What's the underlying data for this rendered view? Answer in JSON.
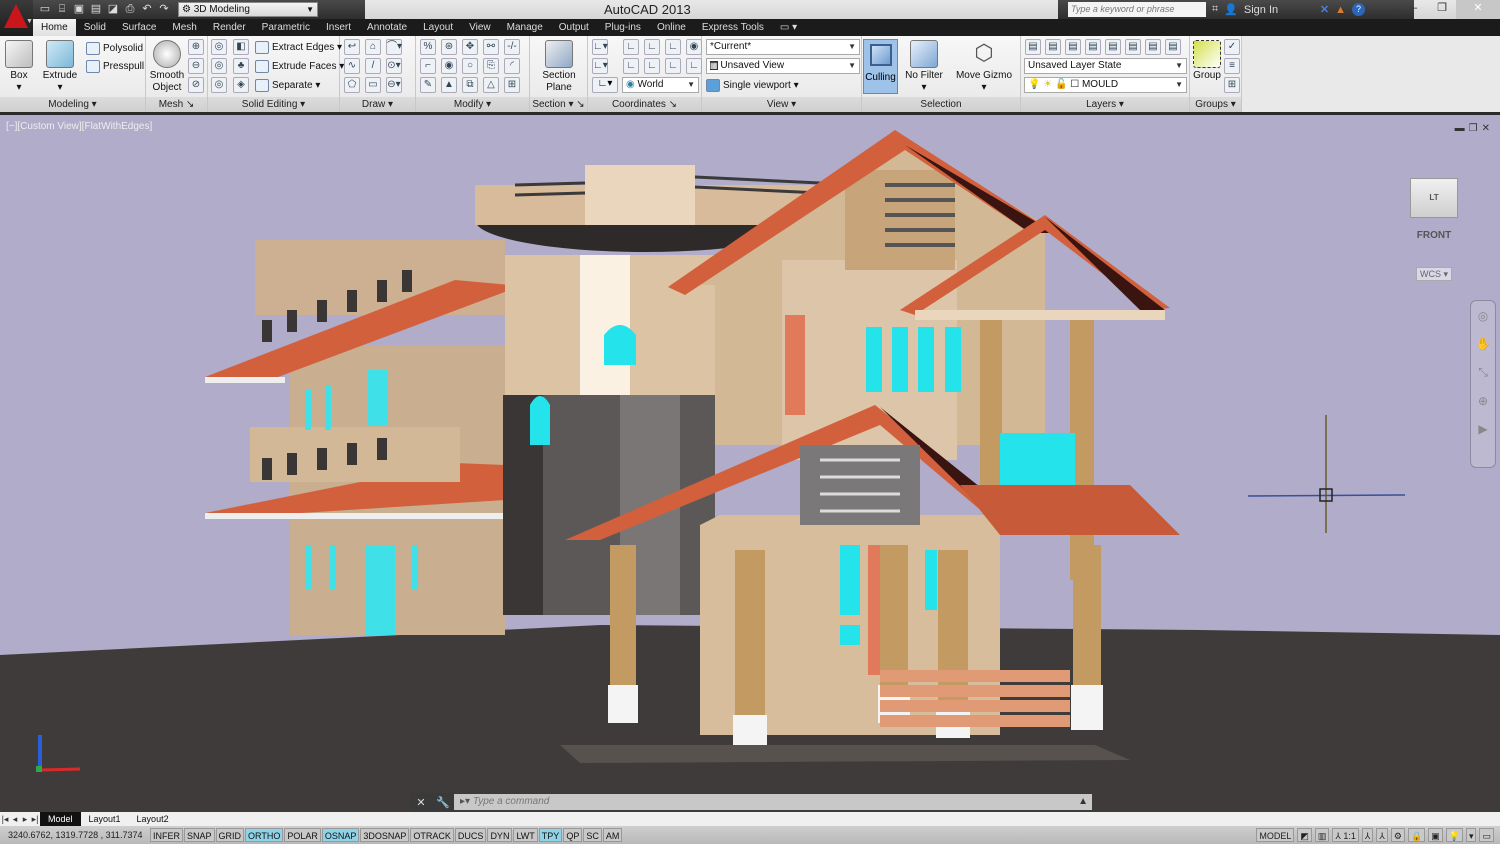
{
  "app": {
    "title": "AutoCAD 2013",
    "workspace": "3D Modeling",
    "search_placeholder": "Type a keyword or phrase",
    "sign_in": "Sign In"
  },
  "quick_access": [
    "new-icon",
    "open-icon",
    "save-icon",
    "saveas-icon",
    "publish-icon",
    "print-icon",
    "undo-icon",
    "redo-icon"
  ],
  "tabs": [
    {
      "label": "Home",
      "active": true
    },
    {
      "label": "Solid"
    },
    {
      "label": "Surface"
    },
    {
      "label": "Mesh"
    },
    {
      "label": "Render"
    },
    {
      "label": "Parametric"
    },
    {
      "label": "Insert"
    },
    {
      "label": "Annotate"
    },
    {
      "label": "Layout"
    },
    {
      "label": "View"
    },
    {
      "label": "Manage"
    },
    {
      "label": "Output"
    },
    {
      "label": "Plug-ins"
    },
    {
      "label": "Online"
    },
    {
      "label": "Express Tools"
    }
  ],
  "ribbon": {
    "modeling": {
      "title": "Modeling",
      "box": "Box",
      "extrude": "Extrude",
      "polysolid": "Polysolid",
      "presspull": "Presspull"
    },
    "mesh": {
      "title": "Mesh",
      "smooth": "Smooth Object"
    },
    "solid_editing": {
      "title": "Solid Editing",
      "extract_edges": "Extract Edges",
      "extrude_faces": "Extrude Faces",
      "separate": "Separate"
    },
    "draw": {
      "title": "Draw"
    },
    "modify": {
      "title": "Modify"
    },
    "section": {
      "title": "Section",
      "section_plane": "Section Plane"
    },
    "coordinates": {
      "title": "Coordinates",
      "ucs": "World"
    },
    "view": {
      "title": "View",
      "visual_style": "*Current*",
      "named_view": "Unsaved View",
      "viewport": "Single viewport"
    },
    "selection": {
      "title": "Selection",
      "culling": "Culling",
      "no_filter": "No Filter",
      "move_gizmo": "Move Gizmo"
    },
    "layers": {
      "title": "Layers",
      "layer_state": "Unsaved Layer State",
      "layer": "MOULD"
    },
    "groups": {
      "title": "Groups",
      "group": "Group"
    }
  },
  "viewport": {
    "label": "[−][Custom View][FlatWithEdges]",
    "viewcube_face": "FRONT",
    "viewcube_side": "LT",
    "ucs_label": "WCS",
    "colors": {
      "sky": "#b0acc9",
      "ground": "#3f3b3a",
      "roof": "#d2603c",
      "wall": "#d9bfa0",
      "glass": "#25e3ea"
    }
  },
  "command_line": {
    "placeholder": "Type a command"
  },
  "layout_tabs": [
    {
      "label": "Model",
      "active": true
    },
    {
      "label": "Layout1"
    },
    {
      "label": "Layout2"
    }
  ],
  "status": {
    "coordinates": "3240.6762, 1319.7728 , 311.7374",
    "toggles": [
      {
        "label": "INFER",
        "on": false
      },
      {
        "label": "SNAP",
        "on": false
      },
      {
        "label": "GRID",
        "on": false
      },
      {
        "label": "ORTHO",
        "on": true
      },
      {
        "label": "POLAR",
        "on": false
      },
      {
        "label": "OSNAP",
        "on": true
      },
      {
        "label": "3DOSNAP",
        "on": false
      },
      {
        "label": "OTRACK",
        "on": false
      },
      {
        "label": "DUCS",
        "on": false
      },
      {
        "label": "DYN",
        "on": false
      },
      {
        "label": "LWT",
        "on": false
      },
      {
        "label": "TPY",
        "on": true
      },
      {
        "label": "QP",
        "on": false
      },
      {
        "label": "SC",
        "on": false
      },
      {
        "label": "AM",
        "on": false
      }
    ],
    "model": "MODEL",
    "scale": "1:1"
  }
}
